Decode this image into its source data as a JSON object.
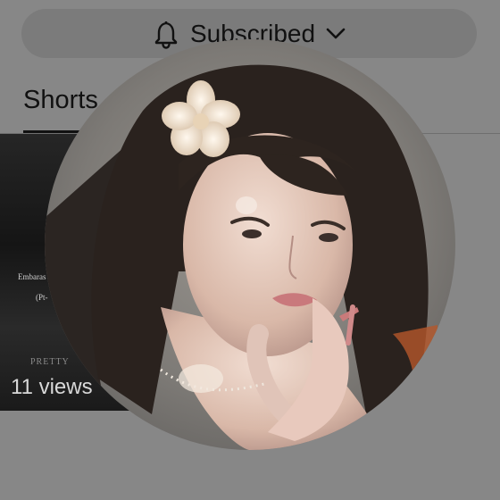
{
  "header": {
    "subscribe_label": "Subscribed",
    "bell_icon": "bell-icon",
    "dropdown_icon": "chevron-down-icon"
  },
  "tabs": {
    "shorts_label": "Shorts"
  },
  "video": {
    "caption": "Embaras",
    "caption_sub": "(Pt-",
    "watermark": "PRETTY",
    "views": "11 views"
  },
  "colors": {
    "overlay": "#878787",
    "button_bg": "#7b7b7b",
    "text": "#111111"
  }
}
